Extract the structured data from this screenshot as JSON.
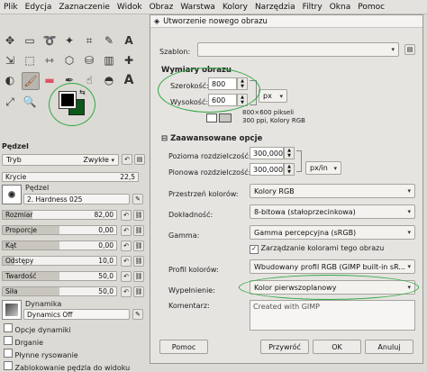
{
  "menubar": [
    "Plik",
    "Edycja",
    "Zaznaczenie",
    "Widok",
    "Obraz",
    "Warstwa",
    "Kolory",
    "Narzędzia",
    "Filtry",
    "Okna",
    "Pomoc"
  ],
  "toolbox": {
    "section_title": "Pędzel",
    "mode_label": "Tryb",
    "mode_value": "Zwykłe",
    "opacity_label": "Krycie",
    "opacity_value": "22,5",
    "brush_label": "Pędzel",
    "brush_value": "2. Hardness 025",
    "sliders": [
      {
        "label": "Rozmiar",
        "value": "82,00",
        "fraction": 0.26
      },
      {
        "label": "Proporcje",
        "value": "0,00",
        "fraction": 0.5
      },
      {
        "label": "Kąt",
        "value": "0,00",
        "fraction": 0.5
      },
      {
        "label": "Odstępy",
        "value": "10,0",
        "fraction": 0.1
      },
      {
        "label": "Twardość",
        "value": "50,0",
        "fraction": 0.5
      },
      {
        "label": "Siła",
        "value": "50,0",
        "fraction": 0.5
      }
    ],
    "dynamics_label": "Dynamika",
    "dynamics_value": "Dynamics Off",
    "checkboxes": [
      "Opcje dynamiki",
      "Drganie",
      "Płynne rysowanie",
      "Zablokowanie pędzla do widoku"
    ]
  },
  "dialog": {
    "title": "Utworzenie nowego obrazu",
    "template_label": "Szablon:",
    "image_size_heading": "Wymiary obrazu",
    "width_label": "Szerokość:",
    "width_value": "800",
    "height_label": "Wysokość:",
    "height_value": "600",
    "unit": "px",
    "info_line1": "800×600 pikseli",
    "info_line2": "300 ppi, Kolory RGB",
    "advanced_heading": "Zaawansowane opcje",
    "xres_label": "Pozioma rozdzielczość:",
    "xres_value": "300,000",
    "yres_label": "Pionowa rozdzielczość:",
    "yres_value": "300,000",
    "res_unit": "px/in",
    "colorspace_label": "Przestrzeń kolorów:",
    "colorspace_value": "Kolory RGB",
    "precision_label": "Dokładność:",
    "precision_value": "8-bitowa (stałoprzecinkowa)",
    "gamma_label": "Gamma:",
    "gamma_value": "Gamma percepcyjna (sRGB)",
    "color_manage_label": "Zarządzanie kolorami tego obrazu",
    "profile_label": "Profil kolorów:",
    "profile_value": "Wbudowany profil RGB (GIMP built-in sR...",
    "fill_label": "Wypełnienie:",
    "fill_value": "Kolor pierwszoplanowy",
    "comment_label": "Komentarz:",
    "comment_value": "Created with GIMP",
    "buttons": {
      "help": "Pomoc",
      "reset": "Przywróć",
      "ok": "OK",
      "cancel": "Anuluj"
    }
  },
  "colors": {
    "foreground": "#000000",
    "background": "#0b5a19",
    "annotation": "#2ea843"
  }
}
